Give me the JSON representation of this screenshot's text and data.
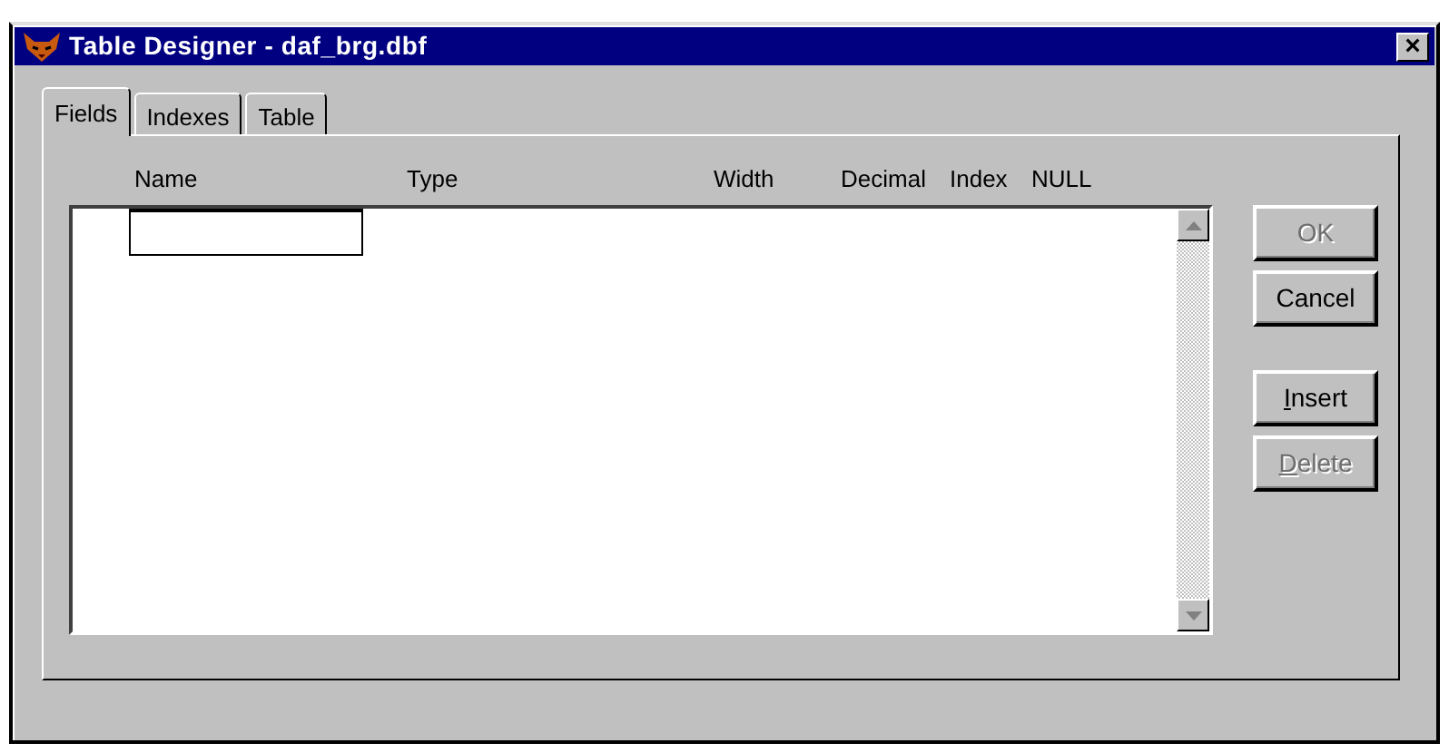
{
  "window": {
    "title": "Table Designer - daf_brg.dbf",
    "close": "×"
  },
  "tabs": [
    {
      "label": "Fields",
      "selected": true
    },
    {
      "label": "Indexes",
      "selected": false
    },
    {
      "label": "Table",
      "selected": false
    }
  ],
  "columns": [
    "Name",
    "Type",
    "Width",
    "Decimal",
    "Index",
    "NULL"
  ],
  "button_groups": [
    [
      {
        "label": "OK",
        "disabled": true,
        "underline_first": false
      },
      {
        "label": "Cancel",
        "disabled": false,
        "underline_first": false
      }
    ],
    [
      {
        "label": "Insert",
        "disabled": false,
        "underline_first": true
      },
      {
        "label": "Delete",
        "disabled": true,
        "underline_first": true
      }
    ]
  ]
}
